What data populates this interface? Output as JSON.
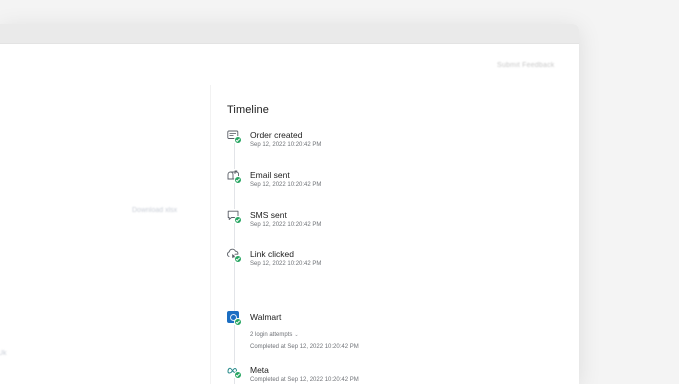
{
  "header": {
    "feedback_label": "Submit Feedback"
  },
  "background": {
    "download_label": "Download xlsx",
    "corner_label": "Uk"
  },
  "timeline": {
    "title": "Timeline",
    "events": [
      {
        "title": "Order created",
        "timestamp": "Sep 12, 2022 10:20:42 PM",
        "icon": "receipt-icon"
      },
      {
        "title": "Email sent",
        "timestamp": "Sep 12, 2022 10:20:42 PM",
        "icon": "mailbox-icon"
      },
      {
        "title": "SMS sent",
        "timestamp": "Sep 12, 2022 10:20:42 PM",
        "icon": "chat-message-icon"
      },
      {
        "title": "Link clicked",
        "timestamp": "Sep 12, 2022 10:20:42 PM",
        "icon": "link-icon"
      },
      {
        "title": "Walmart",
        "attempts": "2 login attempts",
        "completed": "Completed at Sep 12, 2022 10:20:42 PM",
        "icon": "walmart-logo-icon"
      },
      {
        "title": "Meta",
        "completed": "Completed at Sep 12, 2022 10:20:42 PM",
        "icon": "meta-logo-icon"
      }
    ]
  },
  "colors": {
    "success_check": "#27a561",
    "walmart_blue": "#1b6ec2",
    "meta_teal": "#2a8c8c"
  }
}
